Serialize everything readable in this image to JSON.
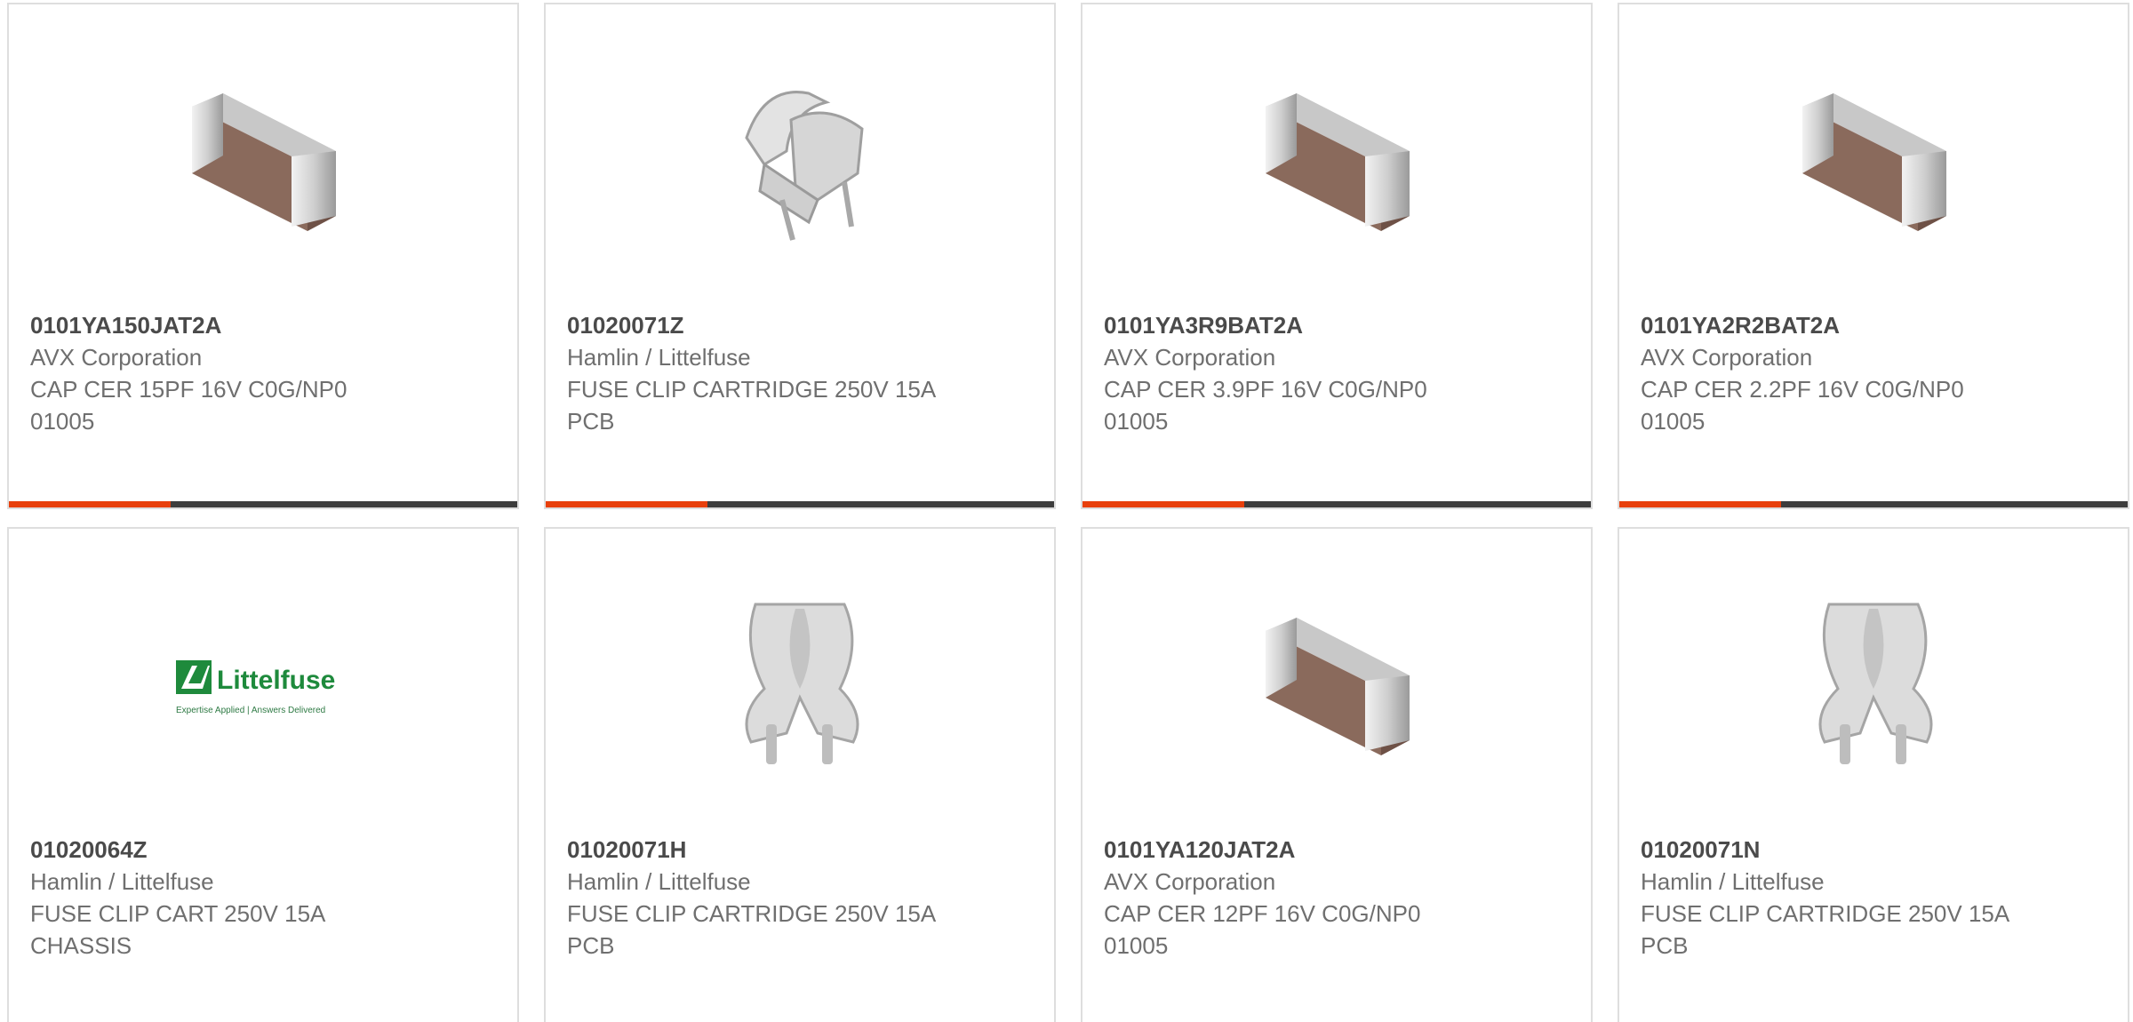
{
  "accent_color": "#e8400c",
  "bar_color": "#3d3d3d",
  "products": [
    {
      "part_number": "0101YA150JAT2A",
      "manufacturer": "AVX Corporation",
      "description": "CAP CER 15PF 16V C0G/NP0 01005",
      "image": "ceramic-capacitor-icon"
    },
    {
      "part_number": "01020071Z",
      "manufacturer": "Hamlin / Littelfuse",
      "description": "FUSE CLIP CARTRIDGE 250V 15A PCB",
      "image": "fuse-clip-icon"
    },
    {
      "part_number": "0101YA3R9BAT2A",
      "manufacturer": "AVX Corporation",
      "description": "CAP CER 3.9PF 16V C0G/NP0 01005",
      "image": "ceramic-capacitor-icon"
    },
    {
      "part_number": "0101YA2R2BAT2A",
      "manufacturer": "AVX Corporation",
      "description": "CAP CER 2.2PF 16V C0G/NP0 01005",
      "image": "ceramic-capacitor-icon"
    },
    {
      "part_number": "01020064Z",
      "manufacturer": "Hamlin / Littelfuse",
      "description": "FUSE CLIP CART 250V 15A CHASSIS",
      "image": "littelfuse-logo",
      "logo_text": "Littelfuse",
      "logo_tagline": "Expertise Applied | Answers Delivered"
    },
    {
      "part_number": "01020071H",
      "manufacturer": "Hamlin / Littelfuse",
      "description": "FUSE CLIP CARTRIDGE 250V 15A PCB",
      "image": "fuse-clip-front-icon"
    },
    {
      "part_number": "0101YA120JAT2A",
      "manufacturer": "AVX Corporation",
      "description": "CAP CER 12PF 16V C0G/NP0 01005",
      "image": "ceramic-capacitor-icon"
    },
    {
      "part_number": "01020071N",
      "manufacturer": "Hamlin / Littelfuse",
      "description": "FUSE CLIP CARTRIDGE 250V 15A PCB",
      "image": "fuse-clip-front-icon"
    }
  ]
}
